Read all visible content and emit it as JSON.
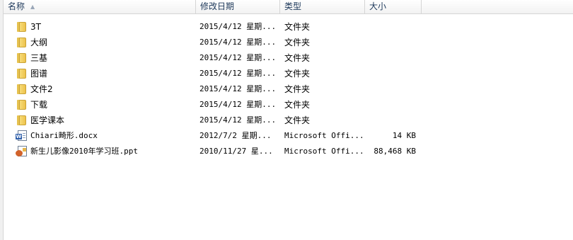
{
  "columns": {
    "name": "名称",
    "date": "修改日期",
    "type": "类型",
    "size": "大小"
  },
  "files": [
    {
      "name": "3T",
      "date": "2015/4/12 星期...",
      "type": "文件夹",
      "size": "",
      "icon": "folder-icon"
    },
    {
      "name": "大纲",
      "date": "2015/4/12 星期...",
      "type": "文件夹",
      "size": "",
      "icon": "folder-icon"
    },
    {
      "name": "三基",
      "date": "2015/4/12 星期...",
      "type": "文件夹",
      "size": "",
      "icon": "folder-icon"
    },
    {
      "name": "图谱",
      "date": "2015/4/12 星期...",
      "type": "文件夹",
      "size": "",
      "icon": "folder-icon"
    },
    {
      "name": "文件2",
      "date": "2015/4/12 星期...",
      "type": "文件夹",
      "size": "",
      "icon": "folder-icon"
    },
    {
      "name": "下载",
      "date": "2015/4/12 星期...",
      "type": "文件夹",
      "size": "",
      "icon": "folder-icon"
    },
    {
      "name": "医学课本",
      "date": "2015/4/12 星期...",
      "type": "文件夹",
      "size": "",
      "icon": "folder-icon"
    },
    {
      "name": "Chiari畸形.docx",
      "date": "2012/7/2 星期...",
      "type": "Microsoft Offi...",
      "size": "14 KB",
      "icon": "word-document-icon"
    },
    {
      "name": "新生儿影像2010年学习班.ppt",
      "date": "2010/11/27 星...",
      "type": "Microsoft Offi...",
      "size": "88,468 KB",
      "icon": "powerpoint-document-icon"
    }
  ]
}
